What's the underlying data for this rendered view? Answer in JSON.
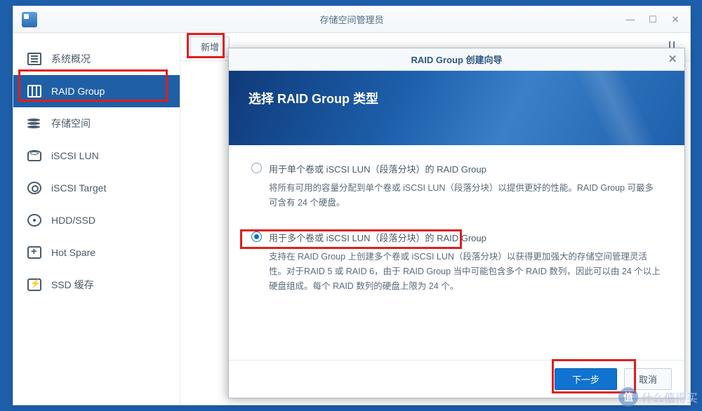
{
  "window": {
    "title": "存储空间管理员",
    "controls": {
      "min": "—",
      "max": "☐",
      "close": "✕"
    }
  },
  "sidebar": {
    "items": [
      {
        "label": "系统概况"
      },
      {
        "label": "RAID Group"
      },
      {
        "label": "存储空间"
      },
      {
        "label": "iSCSI LUN"
      },
      {
        "label": "iSCSI Target"
      },
      {
        "label": "HDD/SSD"
      },
      {
        "label": "Hot Spare"
      },
      {
        "label": "SSD 缓存"
      }
    ]
  },
  "toolbar": {
    "add_label": "新增"
  },
  "modal": {
    "title": "RAID Group 创建向导",
    "header": "选择 RAID Group 类型",
    "option1": {
      "label": "用于单个卷或 iSCSI LUN（段落分块）的 RAID Group",
      "desc": "将所有可用的容量分配到单个卷或 iSCSI LUN（段落分块）以提供更好的性能。RAID Group 可最多可含有 24 个硬盘。"
    },
    "option2": {
      "label": "用于多个卷或 iSCSI LUN（段落分块）的 RAID Group",
      "desc": "支持在 RAID Group 上创建多个卷或 iSCSI LUN（段落分块）以获得更加强大的存储空间管理灵活性。对于RAID 5 或 RAID 6，由于 RAID Group 当中可能包含多个 RAID 数列，因此可以由 24 个以上硬盘组成。每个 RAID 数列的硬盘上限为 24 个。"
    },
    "next_label": "下一步",
    "cancel_label": "取消"
  },
  "watermark": {
    "badge": "值",
    "text": "什么值得买"
  }
}
